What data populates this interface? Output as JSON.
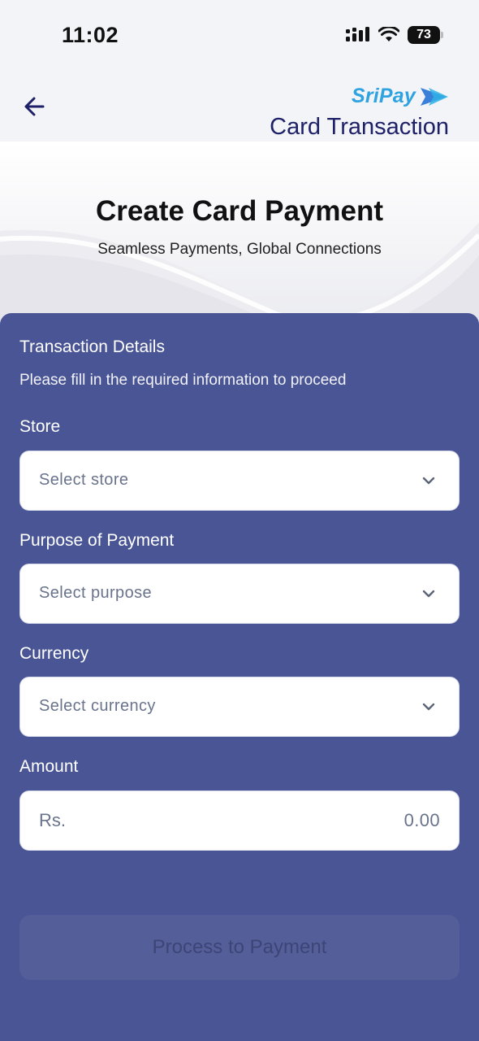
{
  "status_bar": {
    "time": "11:02",
    "battery": "73"
  },
  "header": {
    "brand": "SriPay",
    "title": "Card Transaction"
  },
  "hero": {
    "title": "Create Card Payment",
    "subtitle": "Seamless Payments, Global Connections"
  },
  "form": {
    "section_title": "Transaction Details",
    "section_subtitle": "Please fill in the required information to proceed",
    "store": {
      "label": "Store",
      "placeholder": "Select store"
    },
    "purpose": {
      "label": "Purpose of Payment",
      "placeholder": "Select purpose"
    },
    "currency": {
      "label": "Currency",
      "placeholder": "Select currency"
    },
    "amount": {
      "label": "Amount",
      "prefix": "Rs.",
      "value": "0.00"
    },
    "submit_label": "Process to Payment"
  },
  "colors": {
    "panel": "#4a5596",
    "brand_blue": "#2fa2e0",
    "title_navy": "#1e2167"
  }
}
